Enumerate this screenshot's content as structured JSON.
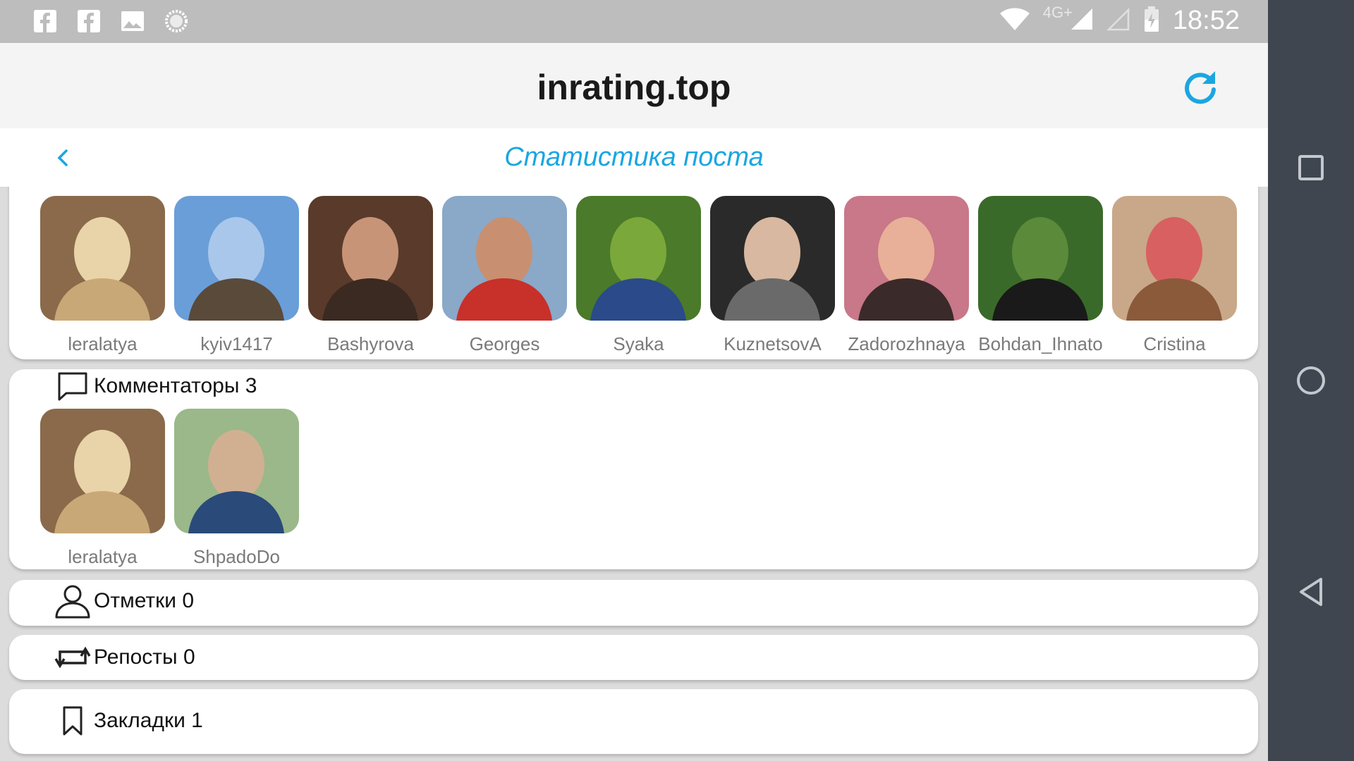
{
  "status_bar": {
    "time": "18:52",
    "network": "4G+",
    "left_icons": [
      "facebook-icon",
      "facebook-icon",
      "image-icon",
      "loading-icon"
    ]
  },
  "app": {
    "title": "inrating.top",
    "subtitle": "Статистика поста"
  },
  "likers": [
    {
      "name": "leralatya",
      "colors": [
        "#8a6a4a",
        "#e8d4a8",
        "#c9a877"
      ]
    },
    {
      "name": "kyiv1417",
      "colors": [
        "#6a9ed8",
        "#a9c7ea",
        "#5a4a3a"
      ]
    },
    {
      "name": "Bashyrova",
      "colors": [
        "#5a3a2a",
        "#c89478",
        "#3a2a22"
      ]
    },
    {
      "name": "Georges",
      "colors": [
        "#8aa8c8",
        "#c89070",
        "#c8302a"
      ]
    },
    {
      "name": "Syaka",
      "colors": [
        "#4a7a2a",
        "#7aa83a",
        "#2a4a8a"
      ]
    },
    {
      "name": "KuznetsovA",
      "colors": [
        "#2a2a2a",
        "#d8b8a0",
        "#6a6a6a"
      ]
    },
    {
      "name": "Zadorozhnaya",
      "colors": [
        "#c87888",
        "#e8b098",
        "#3a2a2a"
      ]
    },
    {
      "name": "Bohdan_Ihnato",
      "colors": [
        "#3a6a2a",
        "#5a8a3a",
        "#1a1a1a"
      ]
    },
    {
      "name": "Cristina",
      "colors": [
        "#c8a888",
        "#d86060",
        "#8a5a3a"
      ]
    }
  ],
  "commenters": {
    "label": "Комментаторы 3",
    "users": [
      {
        "name": "leralatya",
        "colors": [
          "#8a6a4a",
          "#e8d4a8",
          "#c9a877"
        ]
      },
      {
        "name": "ShpadoDo",
        "colors": [
          "#9ab88a",
          "#d0b090",
          "#2a4a7a"
        ]
      }
    ]
  },
  "tags": {
    "label": "Отметки 0"
  },
  "reposts": {
    "label": "Репосты 0"
  },
  "bookmarks": {
    "label": "Закладки 1"
  }
}
